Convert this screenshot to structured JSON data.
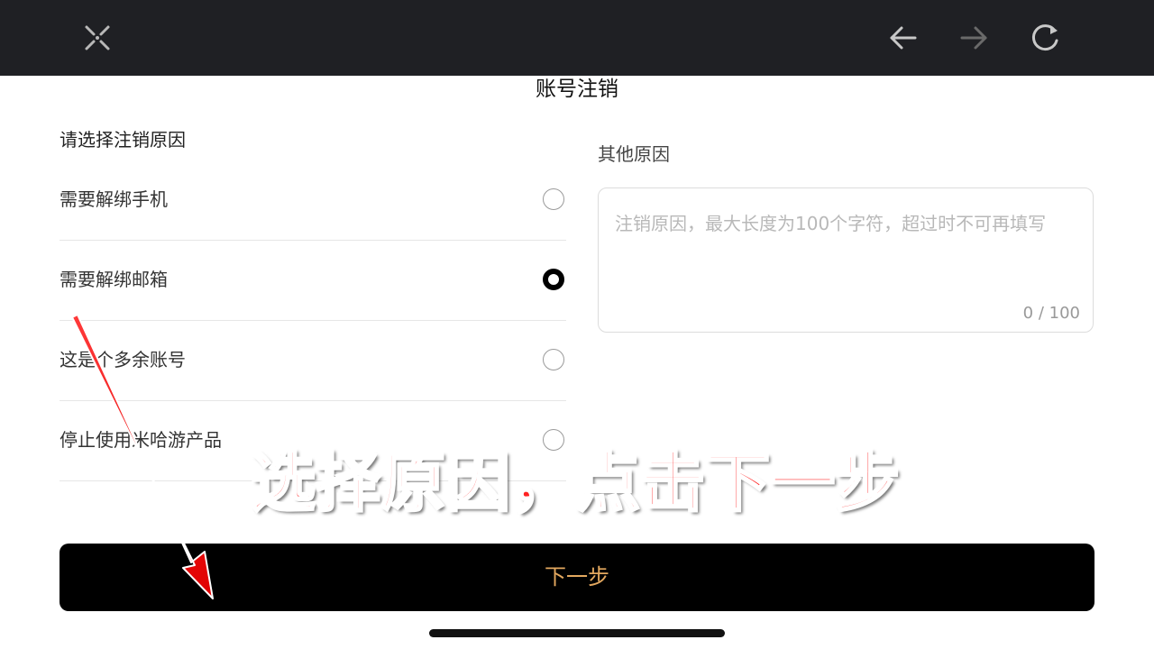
{
  "toolbar": {
    "close_icon": "close-x-icon",
    "back_icon": "arrow-left-icon",
    "forward_icon": "arrow-right-icon",
    "refresh_icon": "refresh-icon"
  },
  "page": {
    "title": "账号注销",
    "section_title": "请选择注销原因"
  },
  "reasons": [
    {
      "label": "需要解绑手机",
      "selected": false
    },
    {
      "label": "需要解绑邮箱",
      "selected": true
    },
    {
      "label": "这是个多余账号",
      "selected": false
    },
    {
      "label": "停止使用米哈游产品",
      "selected": false
    }
  ],
  "other": {
    "label": "其他原因",
    "placeholder": "注销原因，最大长度为100个字符，超过时不可再填写",
    "counter": "0 / 100"
  },
  "annotation": {
    "text": "选择原因，点击下一步",
    "color": "#ff2222"
  },
  "next_button": {
    "label": "下一步",
    "text_color": "#e3a85f"
  }
}
